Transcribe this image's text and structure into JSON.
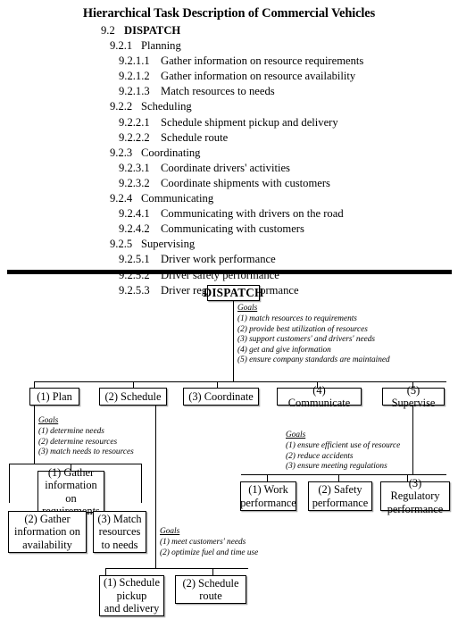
{
  "document": {
    "title": "Hierarchical Task Description of Commercial Vehicles"
  },
  "outline": [
    {
      "level": 1,
      "number": "9.2",
      "text": "DISPATCH"
    },
    {
      "level": 2,
      "number": "9.2.1",
      "text": "Planning"
    },
    {
      "level": 3,
      "number": "9.2.1.1",
      "text": "Gather information on resource requirements"
    },
    {
      "level": 3,
      "number": "9.2.1.2",
      "text": "Gather information on resource availability"
    },
    {
      "level": 3,
      "number": "9.2.1.3",
      "text": "Match resources to needs"
    },
    {
      "level": 2,
      "number": "9.2.2",
      "text": "Scheduling"
    },
    {
      "level": 3,
      "number": "9.2.2.1",
      "text": "Schedule shipment pickup and delivery"
    },
    {
      "level": 3,
      "number": "9.2.2.2",
      "text": "Schedule route"
    },
    {
      "level": 2,
      "number": "9.2.3",
      "text": "Coordinating"
    },
    {
      "level": 3,
      "number": "9.2.3.1",
      "text": "Coordinate drivers' activities"
    },
    {
      "level": 3,
      "number": "9.2.3.2",
      "text": "Coordinate shipments with customers"
    },
    {
      "level": 2,
      "number": "9.2.4",
      "text": "Communicating"
    },
    {
      "level": 3,
      "number": "9.2.4.1",
      "text": "Communicating with drivers on the road"
    },
    {
      "level": 3,
      "number": "9.2.4.2",
      "text": "Communicating with customers"
    },
    {
      "level": 2,
      "number": "9.2.5",
      "text": "Supervising"
    },
    {
      "level": 3,
      "number": "9.2.5.1",
      "text": "Driver work performance"
    },
    {
      "level": 3,
      "number": "9.2.5.2",
      "text": "Driver safety performance"
    },
    {
      "level": 3,
      "number": "9.2.5.3",
      "text": "Driver regulatory performance"
    }
  ],
  "diagram": {
    "root": {
      "label": "DISPATCH"
    },
    "root_goals": {
      "heading": "Goals",
      "items": [
        "(1) match resources to requirements",
        "(2) provide best utilization of resources",
        "(3) support customers' and drivers' needs",
        "(4) get and give information",
        "(5) ensure company standards are maintained"
      ]
    },
    "level1": [
      {
        "label": "(1) Plan"
      },
      {
        "label": "(2) Schedule"
      },
      {
        "label": "(3) Coordinate"
      },
      {
        "label": "(4) Communicate"
      },
      {
        "label": "(5) Supervise"
      }
    ],
    "plan_goals": {
      "heading": "Goals",
      "items": [
        "(1) determine needs",
        "(2) determine resources",
        "(3) match needs to resources"
      ]
    },
    "communicate_goals": {
      "heading": "Goals",
      "items": [
        "(1) ensure efficient use of resource",
        "(2) reduce accidents",
        "(3) ensure meeting regulations"
      ]
    },
    "schedule_goals": {
      "heading": "Goals",
      "items": [
        "(1) meet customers' needs",
        "(2) optimize fuel and time use"
      ]
    },
    "plan_children": [
      {
        "line1": "(1) Gather",
        "line2": "information on",
        "line3": "requirements"
      },
      {
        "line1": "(2) Gather",
        "line2": "information on",
        "line3": "availability"
      },
      {
        "line1": "(3) Match",
        "line2": "resources",
        "line3": "to needs"
      }
    ],
    "supervise_children": [
      {
        "line1": "(1) Work",
        "line2": "performance",
        "line3": ""
      },
      {
        "line1": "(2) Safety",
        "line2": "performance",
        "line3": ""
      },
      {
        "line1": "(3) Regulatory",
        "line2": "performance",
        "line3": ""
      }
    ],
    "schedule_children": [
      {
        "line1": "(1) Schedule",
        "line2": "pickup",
        "line3": "and delivery"
      },
      {
        "line1": "(2) Schedule",
        "line2": "route",
        "line3": ""
      }
    ]
  }
}
